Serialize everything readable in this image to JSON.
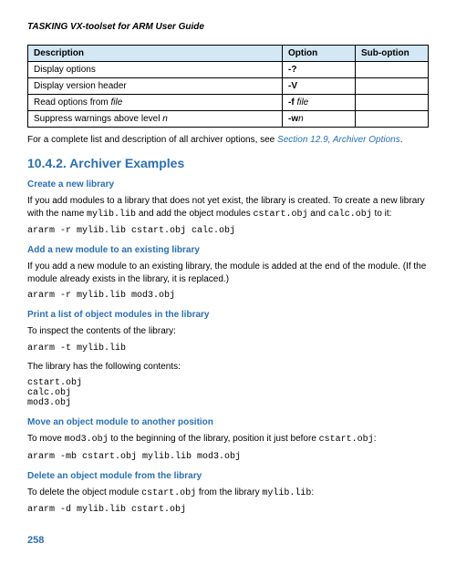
{
  "header": "TASKING VX-toolset for ARM User Guide",
  "table": {
    "headers": {
      "desc": "Description",
      "opt": "Option",
      "subopt": "Sub-option"
    },
    "rows": [
      {
        "desc": "Display options",
        "opt": "-?",
        "subopt": ""
      },
      {
        "desc": "Display version header",
        "opt": "-V",
        "subopt": ""
      },
      {
        "desc_pre": "Read options from ",
        "desc_ital": "file",
        "opt_pre": "-f ",
        "opt_ital": "file",
        "subopt": ""
      },
      {
        "desc_pre": "Suppress warnings above level ",
        "desc_ital": "n",
        "opt_pre": "-w",
        "opt_ital": "n",
        "subopt": ""
      }
    ]
  },
  "caption_pre": "For a complete list and description of all archiver options, see ",
  "caption_link": "Section 12.9, Archiver Options",
  "caption_post": ".",
  "section_title": "10.4.2. Archiver Examples",
  "ex1": {
    "title": "Create a new library",
    "p1a": "If you add modules to a library that does not yet exist, the library is created. To create a new library with the name ",
    "p1b": "mylib.lib",
    "p1c": " and add the object modules ",
    "p1d": "cstart.obj",
    "p1e": " and ",
    "p1f": "calc.obj",
    "p1g": " to it:",
    "code": "ararm -r mylib.lib cstart.obj calc.obj"
  },
  "ex2": {
    "title": "Add a new module to an existing library",
    "p": "If you add a new module to an existing library, the module is added at the end of the module. (If the module already exists in the library, it is replaced.)",
    "code": "ararm -r mylib.lib mod3.obj"
  },
  "ex3": {
    "title": "Print a list of object modules in the library",
    "p1": "To inspect the contents of the library:",
    "code1": "ararm -t mylib.lib",
    "p2": "The library has the following contents:",
    "code2": "cstart.obj\ncalc.obj\nmod3.obj"
  },
  "ex4": {
    "title": "Move an object module to another position",
    "p1a": "To move ",
    "p1b": "mod3.obj",
    "p1c": " to the beginning of the library, position it just before ",
    "p1d": "cstart.obj",
    "p1e": ":",
    "code": "ararm -mb cstart.obj mylib.lib mod3.obj"
  },
  "ex5": {
    "title": "Delete an object module from the library",
    "p1a": "To delete the object module ",
    "p1b": "cstart.obj",
    "p1c": " from the library ",
    "p1d": "mylib.lib",
    "p1e": ":",
    "code": "ararm -d mylib.lib cstart.obj"
  },
  "pagenum": "258"
}
